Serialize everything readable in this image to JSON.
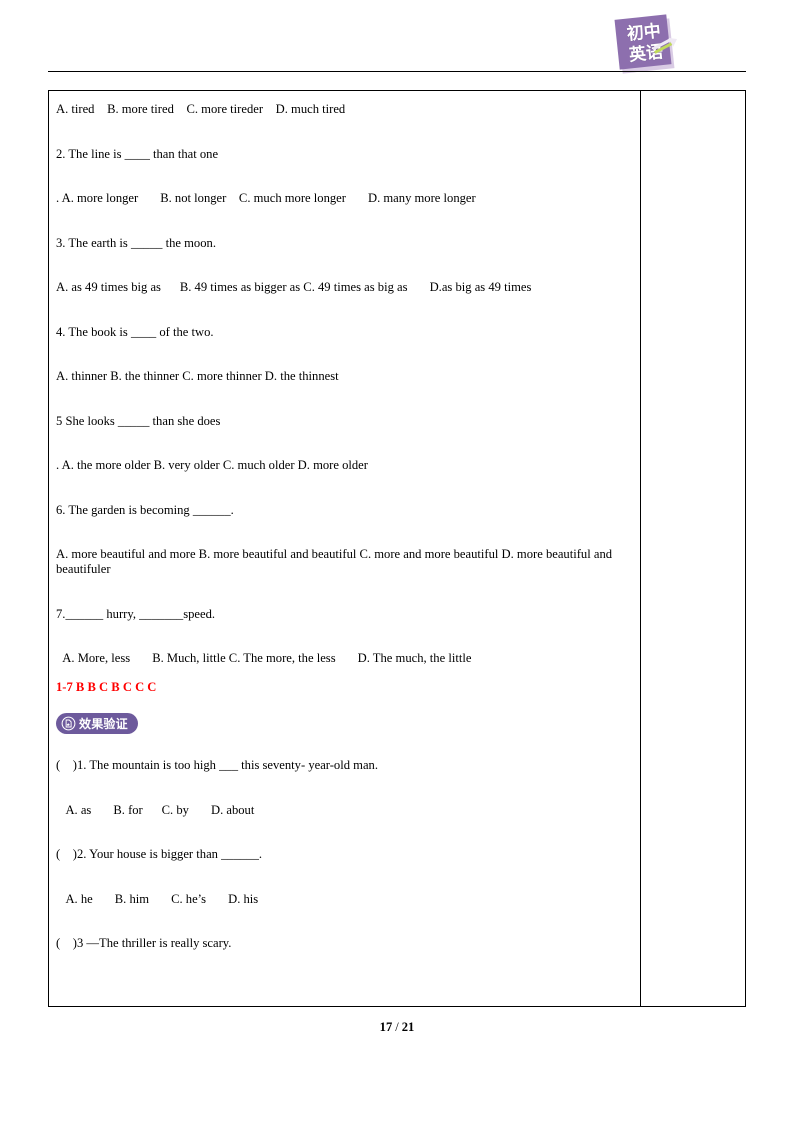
{
  "header": {
    "logo": {
      "line1": "初中",
      "line2": "英语",
      "color": "#8d6fae",
      "icon": "pencil-icon"
    }
  },
  "document": {
    "lines": [
      "A. tired    B. more tired    C. more tireder    D. much tired",
      "2. The line is ____ than that one",
      ". A. more longer       B. not longer    C. much more longer       D. many more longer",
      "3. The earth is _____ the moon.",
      "A. as 49 times big as      B. 49 times as bigger as C. 49 times as big as       D.as big as 49 times",
      "4. The book is ____ of the two.",
      "A. thinner B. the thinner C. more thinner D. the thinnest",
      "5 She looks _____ than she does",
      ". A. the more older B. very older C. much older D. more older",
      "6. The garden is becoming ______.",
      "A. more beautiful and more B. more beautiful and beautiful C. more and more beautiful D. more beautiful and beautifuler",
      "7.______ hurry, _______speed.",
      "  A. More, less       B. Much, little C. The more, the less       D. The much, the little"
    ],
    "answer_key": "1-7 B B C B C C C",
    "badge": {
      "label": "效果验证",
      "icon": "verify-circle-icon",
      "background": "#6d5a9c"
    },
    "verify_lines": [
      "(    )1. The mountain is too high ___ this seventy- year-old man.",
      "   A. as       B. for      C. by       D. about",
      "(    )2. Your house is bigger than ______.",
      "   A. he       B. him       C. he’s       D. his",
      "(    )3 —The thriller is really scary."
    ]
  },
  "footer": {
    "current_page": "17",
    "separator": "/",
    "total_pages": "21"
  }
}
